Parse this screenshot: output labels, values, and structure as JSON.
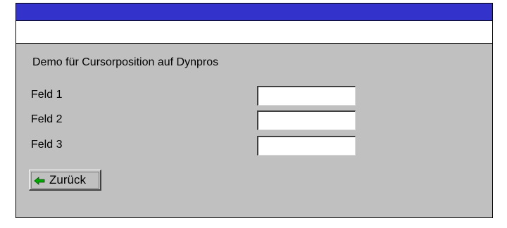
{
  "screen": {
    "heading": "Demo für Cursorposition auf Dynpros",
    "fields": [
      {
        "label": "Feld 1",
        "value": ""
      },
      {
        "label": "Feld 2",
        "value": ""
      },
      {
        "label": "Feld 3",
        "value": ""
      }
    ]
  },
  "buttons": {
    "back": {
      "label": "Zurück",
      "icon": "arrow-left-icon"
    }
  },
  "colors": {
    "title_bar": "#3333cc",
    "panel": "#c0c0c0",
    "icon_arrow": "#00aa00"
  }
}
